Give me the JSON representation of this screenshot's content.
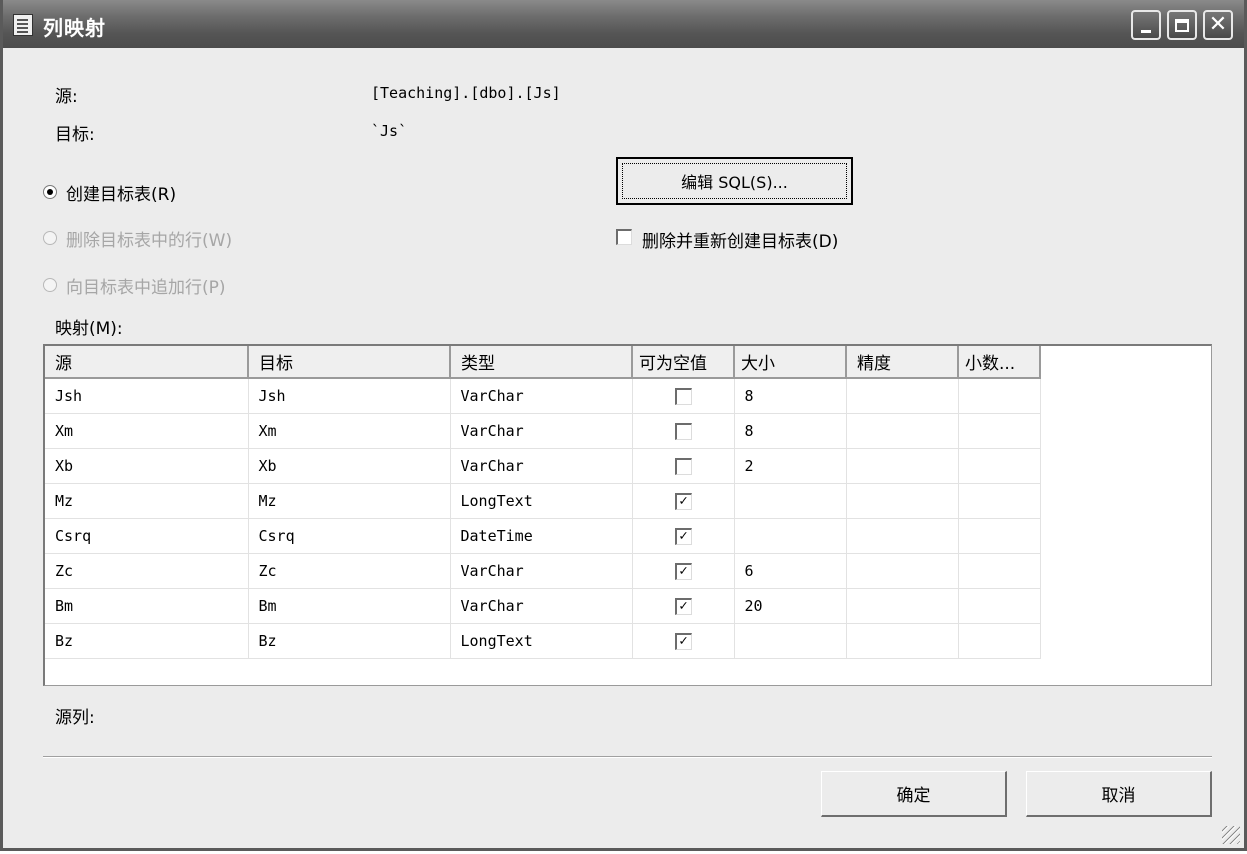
{
  "window": {
    "title": "列映射"
  },
  "info": {
    "source_label": "源:",
    "source_value": "[Teaching].[dbo].[Js]",
    "target_label": "目标:",
    "target_value": "`Js`"
  },
  "options": {
    "create_table": "创建目标表(R)",
    "delete_rows": "删除目标表中的行(W)",
    "append_rows": "向目标表中追加行(P)",
    "edit_sql": "编辑 SQL(S)...",
    "drop_recreate": "删除并重新创建目标表(D)",
    "mappings_label": "映射(M):"
  },
  "table": {
    "columns": [
      "源",
      "目标",
      "类型",
      "可为空值",
      "大小",
      "精度",
      "小数..."
    ],
    "rows": [
      {
        "source": "Jsh",
        "target": "Jsh",
        "type": "VarChar",
        "nullable": false,
        "size": "8",
        "precision": "",
        "scale": ""
      },
      {
        "source": "Xm",
        "target": "Xm",
        "type": "VarChar",
        "nullable": false,
        "size": "8",
        "precision": "",
        "scale": ""
      },
      {
        "source": "Xb",
        "target": "Xb",
        "type": "VarChar",
        "nullable": false,
        "size": "2",
        "precision": "",
        "scale": ""
      },
      {
        "source": "Mz",
        "target": "Mz",
        "type": "LongText",
        "nullable": true,
        "size": "",
        "precision": "",
        "scale": ""
      },
      {
        "source": "Csrq",
        "target": "Csrq",
        "type": "DateTime",
        "nullable": true,
        "size": "",
        "precision": "",
        "scale": ""
      },
      {
        "source": "Zc",
        "target": "Zc",
        "type": "VarChar",
        "nullable": true,
        "size": "6",
        "precision": "",
        "scale": ""
      },
      {
        "source": "Bm",
        "target": "Bm",
        "type": "VarChar",
        "nullable": true,
        "size": "20",
        "precision": "",
        "scale": ""
      },
      {
        "source": "Bz",
        "target": "Bz",
        "type": "LongText",
        "nullable": true,
        "size": "",
        "precision": "",
        "scale": ""
      }
    ]
  },
  "footer": {
    "source_column_label": "源列:",
    "ok": "确定",
    "cancel": "取消"
  },
  "icons": {
    "app": "document-icon",
    "minimize": "minimize-icon",
    "maximize": "maximize-icon",
    "close": "close-icon",
    "check": "checkmark-icon"
  }
}
